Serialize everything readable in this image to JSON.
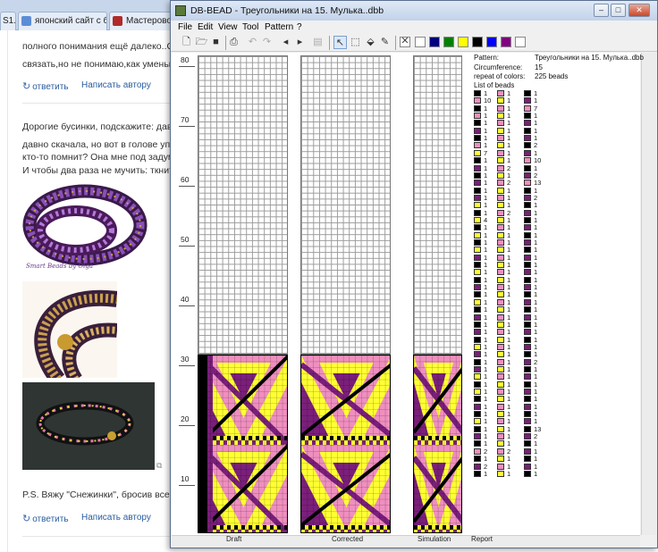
{
  "browser": {
    "tabs": [
      {
        "label": "S1...",
        "color": "#3a72b8"
      },
      {
        "label": "японский сайт с би...",
        "color": "#5b8dd6"
      },
      {
        "label": "Мастеровой",
        "color": "#b02a2a"
      }
    ],
    "comment1": {
      "line1": "полного понимания ещё далеко..Оч",
      "line2": "связать,но не понимаю,как уменьш"
    },
    "reply_label": "ответить",
    "write_author_label": "Написать автору",
    "comment2": {
      "line1": "Дорогие бусинки, подскажите: дав",
      "line2": "давно скачала, но вот в голове упо",
      "line3": "кто-то помнит? Она мне под задум",
      "line4": "И чтобы два раза не мучить: ткнит"
    },
    "photo_caption": "Smart Beads by Olga",
    "comment3": {
      "line1": "P.S. Вяжу \"Снежинки\", бросив все"
    }
  },
  "app": {
    "title": "DB-BEAD - Треугольники на 15. Мулька..dbb",
    "menu": [
      "File",
      "Edit",
      "View",
      "Tool",
      "Pattern",
      "?"
    ],
    "window_buttons": {
      "minimize": "–",
      "maximize": "□",
      "close": "✕"
    },
    "toolbar_icons": [
      "new-icon",
      "open-icon",
      "save-icon",
      "print-icon",
      "undo-icon",
      "redo-icon",
      "arrow-left-icon",
      "arrow-right-icon",
      "preview-icon",
      "pointer-icon",
      "select-icon",
      "fill-icon",
      "pipette-icon"
    ],
    "palette": [
      "#ffffff",
      "#ffffff",
      "#000080",
      "#008000",
      "#ffff00",
      "#000000",
      "#0000ff",
      "#800080",
      "#ffffff"
    ],
    "y_labels": [
      "80",
      "70",
      "60",
      "50",
      "40",
      "30",
      "20",
      "10"
    ],
    "panels": {
      "draft": "Draft",
      "corrected": "Corrected",
      "simulation": "Simulation",
      "report": "Report"
    },
    "colors": {
      "black": "#000000",
      "purple": "#7a1f7a",
      "pink": "#ef8fbf",
      "yellow": "#ffff33",
      "white": "#ffffff"
    },
    "report": {
      "pattern_label": "Pattern:",
      "pattern_value": "Треугольники на 15. Мулька..dbb",
      "circumference_label": "Circumference:",
      "circumference_value": "15",
      "repeat_label": "repeat of colors:",
      "repeat_value": "225 beads",
      "list_label": "List of beads",
      "bead_columns": [
        [
          [
            "black",
            "1"
          ],
          [
            "pink",
            "10"
          ],
          [
            "black",
            "1"
          ],
          [
            "pink",
            "1"
          ],
          [
            "black",
            "1"
          ],
          [
            "purple",
            "1"
          ],
          [
            "black",
            "1"
          ],
          [
            "pink",
            "1"
          ],
          [
            "yellow",
            "7"
          ],
          [
            "black",
            "1"
          ],
          [
            "purple",
            "1"
          ],
          [
            "black",
            "1"
          ],
          [
            "purple",
            "1"
          ],
          [
            "black",
            "1"
          ],
          [
            "purple",
            "1"
          ],
          [
            "yellow",
            "1"
          ],
          [
            "black",
            "1"
          ],
          [
            "yellow",
            "4"
          ],
          [
            "black",
            "1"
          ],
          [
            "yellow",
            "1"
          ],
          [
            "black",
            "1"
          ],
          [
            "yellow",
            "1"
          ],
          [
            "purple",
            "1"
          ],
          [
            "black",
            "1"
          ],
          [
            "yellow",
            "1"
          ],
          [
            "black",
            "1"
          ],
          [
            "purple",
            "1"
          ],
          [
            "black",
            "1"
          ],
          [
            "yellow",
            "1"
          ],
          [
            "black",
            "1"
          ],
          [
            "purple",
            "1"
          ],
          [
            "black",
            "1"
          ],
          [
            "purple",
            "1"
          ],
          [
            "black",
            "1"
          ],
          [
            "yellow",
            "1"
          ],
          [
            "purple",
            "1"
          ],
          [
            "black",
            "1"
          ],
          [
            "purple",
            "1"
          ],
          [
            "yellow",
            "1"
          ],
          [
            "black",
            "1"
          ],
          [
            "yellow",
            "1"
          ],
          [
            "black",
            "1"
          ],
          [
            "purple",
            "1"
          ],
          [
            "black",
            "1"
          ],
          [
            "yellow",
            "1"
          ],
          [
            "black",
            "1"
          ],
          [
            "purple",
            "1"
          ],
          [
            "black",
            "1"
          ],
          [
            "pink",
            "2"
          ],
          [
            "black",
            "1"
          ],
          [
            "purple",
            "2"
          ],
          [
            "black",
            "1"
          ]
        ],
        [
          [
            "pink",
            "1"
          ],
          [
            "yellow",
            "1"
          ],
          [
            "pink",
            "1"
          ],
          [
            "yellow",
            "1"
          ],
          [
            "pink",
            "1"
          ],
          [
            "yellow",
            "1"
          ],
          [
            "pink",
            "1"
          ],
          [
            "yellow",
            "1"
          ],
          [
            "pink",
            "1"
          ],
          [
            "yellow",
            "1"
          ],
          [
            "pink",
            "2"
          ],
          [
            "yellow",
            "1"
          ],
          [
            "pink",
            "2"
          ],
          [
            "yellow",
            "1"
          ],
          [
            "pink",
            "1"
          ],
          [
            "yellow",
            "1"
          ],
          [
            "pink",
            "2"
          ],
          [
            "yellow",
            "1"
          ],
          [
            "pink",
            "1"
          ],
          [
            "yellow",
            "1"
          ],
          [
            "pink",
            "1"
          ],
          [
            "yellow",
            "1"
          ],
          [
            "pink",
            "1"
          ],
          [
            "yellow",
            "1"
          ],
          [
            "pink",
            "1"
          ],
          [
            "yellow",
            "1"
          ],
          [
            "pink",
            "1"
          ],
          [
            "yellow",
            "1"
          ],
          [
            "pink",
            "1"
          ],
          [
            "yellow",
            "1"
          ],
          [
            "pink",
            "1"
          ],
          [
            "yellow",
            "1"
          ],
          [
            "pink",
            "1"
          ],
          [
            "yellow",
            "1"
          ],
          [
            "pink",
            "1"
          ],
          [
            "yellow",
            "1"
          ],
          [
            "pink",
            "1"
          ],
          [
            "yellow",
            "1"
          ],
          [
            "pink",
            "1"
          ],
          [
            "yellow",
            "1"
          ],
          [
            "pink",
            "1"
          ],
          [
            "yellow",
            "1"
          ],
          [
            "pink",
            "1"
          ],
          [
            "yellow",
            "1"
          ],
          [
            "pink",
            "1"
          ],
          [
            "yellow",
            "1"
          ],
          [
            "pink",
            "1"
          ],
          [
            "yellow",
            "1"
          ],
          [
            "pink",
            "2"
          ],
          [
            "yellow",
            "1"
          ],
          [
            "pink",
            "1"
          ],
          [
            "yellow",
            "1"
          ]
        ],
        [
          [
            "black",
            "1"
          ],
          [
            "purple",
            "1"
          ],
          [
            "pink",
            "7"
          ],
          [
            "black",
            "1"
          ],
          [
            "purple",
            "1"
          ],
          [
            "black",
            "1"
          ],
          [
            "purple",
            "1"
          ],
          [
            "black",
            "2"
          ],
          [
            "purple",
            "1"
          ],
          [
            "pink",
            "10"
          ],
          [
            "black",
            "1"
          ],
          [
            "purple",
            "2"
          ],
          [
            "pink",
            "13"
          ],
          [
            "black",
            "1"
          ],
          [
            "purple",
            "2"
          ],
          [
            "black",
            "1"
          ],
          [
            "purple",
            "1"
          ],
          [
            "black",
            "1"
          ],
          [
            "purple",
            "1"
          ],
          [
            "black",
            "1"
          ],
          [
            "purple",
            "1"
          ],
          [
            "black",
            "1"
          ],
          [
            "purple",
            "1"
          ],
          [
            "black",
            "1"
          ],
          [
            "purple",
            "1"
          ],
          [
            "black",
            "1"
          ],
          [
            "purple",
            "1"
          ],
          [
            "black",
            "1"
          ],
          [
            "purple",
            "1"
          ],
          [
            "black",
            "1"
          ],
          [
            "purple",
            "1"
          ],
          [
            "black",
            "1"
          ],
          [
            "purple",
            "1"
          ],
          [
            "black",
            "1"
          ],
          [
            "purple",
            "1"
          ],
          [
            "black",
            "1"
          ],
          [
            "purple",
            "2"
          ],
          [
            "black",
            "1"
          ],
          [
            "purple",
            "1"
          ],
          [
            "black",
            "1"
          ],
          [
            "purple",
            "1"
          ],
          [
            "black",
            "1"
          ],
          [
            "purple",
            "1"
          ],
          [
            "black",
            "1"
          ],
          [
            "purple",
            "1"
          ],
          [
            "black",
            "13"
          ],
          [
            "purple",
            "2"
          ],
          [
            "black",
            "1"
          ],
          [
            "purple",
            "1"
          ],
          [
            "black",
            "1"
          ],
          [
            "purple",
            "1"
          ],
          [
            "black",
            "1"
          ]
        ]
      ]
    }
  }
}
